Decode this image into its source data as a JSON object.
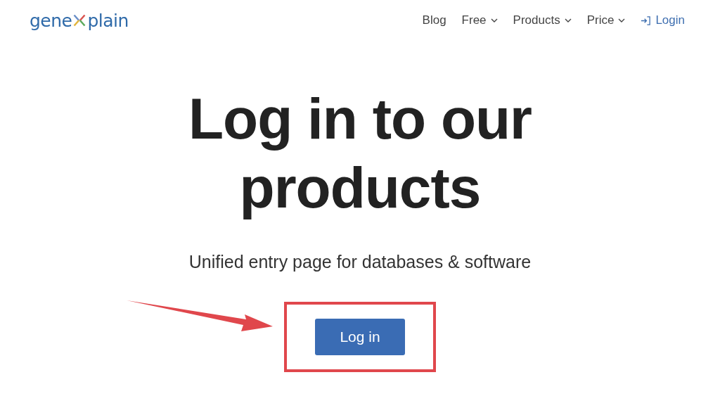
{
  "logo": {
    "left": "gene",
    "right": "plain"
  },
  "nav": [
    {
      "label": "Blog",
      "kind": "link"
    },
    {
      "label": "Free",
      "kind": "menu"
    },
    {
      "label": "Products",
      "kind": "menu"
    },
    {
      "label": "Price",
      "kind": "menu"
    },
    {
      "label": "Login",
      "kind": "login"
    }
  ],
  "hero": {
    "title_lines": [
      "Log in to our",
      "products"
    ],
    "subtitle": "Unified entry page for databases & software",
    "button": "Log in"
  },
  "annotation": {
    "highlight": true,
    "arrow": true
  }
}
